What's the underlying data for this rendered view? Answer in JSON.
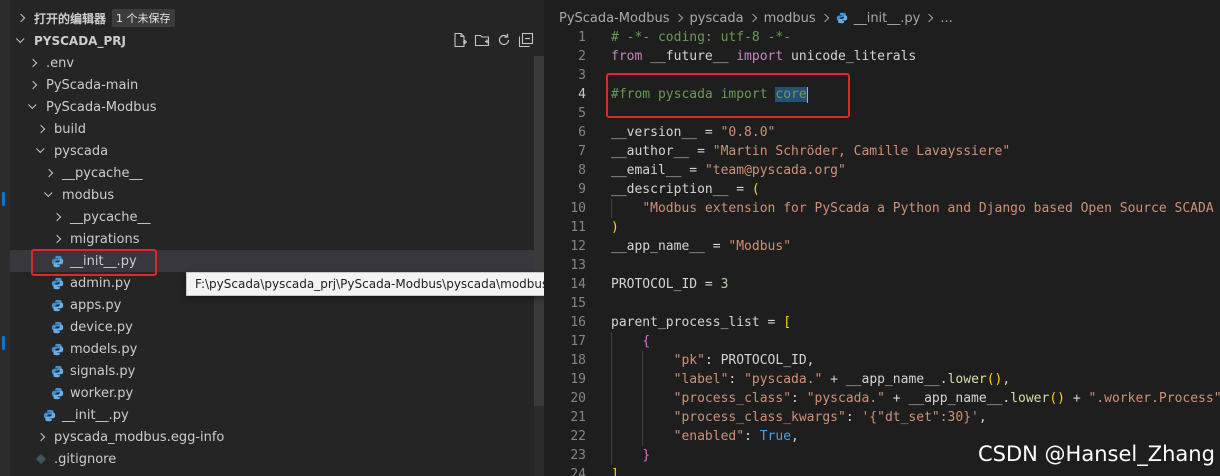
{
  "explorer": {
    "open_editors_label": "打开的编辑器",
    "unsaved_badge": "1 个未保存",
    "project_name": "PYSCADA_PRJ",
    "tree": [
      {
        "label": ".env",
        "kind": "folder",
        "expanded": false,
        "depth": 1
      },
      {
        "label": "PyScada-main",
        "kind": "folder",
        "expanded": false,
        "depth": 1
      },
      {
        "label": "PyScada-Modbus",
        "kind": "folder",
        "expanded": true,
        "depth": 1
      },
      {
        "label": "build",
        "kind": "folder",
        "expanded": false,
        "depth": 2
      },
      {
        "label": "pyscada",
        "kind": "folder",
        "expanded": true,
        "depth": 2
      },
      {
        "label": "__pycache__",
        "kind": "folder",
        "expanded": false,
        "depth": 3
      },
      {
        "label": "modbus",
        "kind": "folder",
        "expanded": true,
        "depth": 3
      },
      {
        "label": "__pycache__",
        "kind": "folder",
        "expanded": false,
        "depth": 4
      },
      {
        "label": "migrations",
        "kind": "folder",
        "expanded": false,
        "depth": 4
      },
      {
        "label": "__init__.py",
        "kind": "python",
        "depth": 4,
        "selected": true
      },
      {
        "label": "admin.py",
        "kind": "python",
        "depth": 4
      },
      {
        "label": "apps.py",
        "kind": "python",
        "depth": 4
      },
      {
        "label": "device.py",
        "kind": "python",
        "depth": 4
      },
      {
        "label": "models.py",
        "kind": "python",
        "depth": 4
      },
      {
        "label": "signals.py",
        "kind": "python",
        "depth": 4
      },
      {
        "label": "worker.py",
        "kind": "python",
        "depth": 4
      },
      {
        "label": "__init__.py",
        "kind": "python",
        "depth": 3
      },
      {
        "label": "pyscada_modbus.egg-info",
        "kind": "folder",
        "expanded": false,
        "depth": 2
      },
      {
        "label": ".gitignore",
        "kind": "git",
        "depth": 2
      }
    ],
    "tooltip": "F:\\pyScada\\pyscada_prj\\PyScada-Modbus\\pyscada\\modbus\\__init__.py"
  },
  "breadcrumb": {
    "items": [
      "PyScada-Modbus",
      "pyscada",
      "modbus",
      "__init__.py",
      "..."
    ]
  },
  "editor": {
    "current_line": 4,
    "lines": [
      {
        "n": "1",
        "indent": 0,
        "tokens": [
          {
            "t": "# -*- coding: utf-8 -*-",
            "c": "com"
          }
        ]
      },
      {
        "n": "2",
        "indent": 0,
        "tokens": [
          {
            "t": "from",
            "c": "kw2"
          },
          {
            "t": " __future__ ",
            "c": ""
          },
          {
            "t": "import",
            "c": "kw2"
          },
          {
            "t": " unicode_literals",
            "c": ""
          }
        ]
      },
      {
        "n": "3",
        "indent": 0,
        "tokens": []
      },
      {
        "n": "4",
        "indent": 0,
        "tokens": [
          {
            "t": "#from pyscada import ",
            "c": "com"
          },
          {
            "t": "core",
            "c": "com sel"
          },
          {
            "t": "",
            "c": "cursor"
          }
        ]
      },
      {
        "n": "5",
        "indent": 0,
        "tokens": []
      },
      {
        "n": "6",
        "indent": 0,
        "tokens": [
          {
            "t": "__version__",
            "c": ""
          },
          {
            "t": " = ",
            "c": ""
          },
          {
            "t": "\"0.8.0\"",
            "c": "str"
          }
        ]
      },
      {
        "n": "7",
        "indent": 0,
        "tokens": [
          {
            "t": "__author__",
            "c": ""
          },
          {
            "t": " = ",
            "c": ""
          },
          {
            "t": "\"Martin Schröder, Camille Lavayssiere\"",
            "c": "str"
          }
        ]
      },
      {
        "n": "8",
        "indent": 0,
        "tokens": [
          {
            "t": "__email__",
            "c": ""
          },
          {
            "t": " = ",
            "c": ""
          },
          {
            "t": "\"team@pyscada.org\"",
            "c": "str"
          }
        ]
      },
      {
        "n": "9",
        "indent": 0,
        "tokens": [
          {
            "t": "__description__",
            "c": ""
          },
          {
            "t": " = ",
            "c": ""
          },
          {
            "t": "(",
            "c": "br1"
          }
        ]
      },
      {
        "n": "10",
        "indent": 1,
        "tokens": [
          {
            "t": "    ",
            "c": ""
          },
          {
            "t": "\"Modbus extension for PyScada a Python and Django based Open Source SCADA System\"",
            "c": "str"
          }
        ]
      },
      {
        "n": "11",
        "indent": 0,
        "tokens": [
          {
            "t": ")",
            "c": "br1"
          }
        ]
      },
      {
        "n": "12",
        "indent": 0,
        "tokens": [
          {
            "t": "__app_name__",
            "c": ""
          },
          {
            "t": " = ",
            "c": ""
          },
          {
            "t": "\"Modbus\"",
            "c": "str"
          }
        ]
      },
      {
        "n": "13",
        "indent": 0,
        "tokens": []
      },
      {
        "n": "14",
        "indent": 0,
        "tokens": [
          {
            "t": "PROTOCOL_ID",
            "c": ""
          },
          {
            "t": " = ",
            "c": ""
          },
          {
            "t": "3",
            "c": "num"
          }
        ]
      },
      {
        "n": "15",
        "indent": 0,
        "tokens": []
      },
      {
        "n": "16",
        "indent": 0,
        "tokens": [
          {
            "t": "parent_process_list",
            "c": ""
          },
          {
            "t": " = ",
            "c": ""
          },
          {
            "t": "[",
            "c": "br1"
          }
        ]
      },
      {
        "n": "17",
        "indent": 1,
        "tokens": [
          {
            "t": "    ",
            "c": ""
          },
          {
            "t": "{",
            "c": "br2"
          }
        ]
      },
      {
        "n": "18",
        "indent": 2,
        "tokens": [
          {
            "t": "        ",
            "c": ""
          },
          {
            "t": "\"pk\"",
            "c": "str"
          },
          {
            "t": ": PROTOCOL_ID,",
            "c": ""
          }
        ]
      },
      {
        "n": "19",
        "indent": 2,
        "tokens": [
          {
            "t": "        ",
            "c": ""
          },
          {
            "t": "\"label\"",
            "c": "str"
          },
          {
            "t": ": ",
            "c": ""
          },
          {
            "t": "\"pyscada.\"",
            "c": "str"
          },
          {
            "t": " + __app_name__.",
            "c": ""
          },
          {
            "t": "lower",
            "c": "fn"
          },
          {
            "t": "()",
            "c": "br1"
          },
          {
            "t": ",",
            "c": ""
          }
        ]
      },
      {
        "n": "20",
        "indent": 2,
        "tokens": [
          {
            "t": "        ",
            "c": ""
          },
          {
            "t": "\"process_class\"",
            "c": "str"
          },
          {
            "t": ": ",
            "c": ""
          },
          {
            "t": "\"pyscada.\"",
            "c": "str"
          },
          {
            "t": " + __app_name__.",
            "c": ""
          },
          {
            "t": "lower",
            "c": "fn"
          },
          {
            "t": "()",
            "c": "br1"
          },
          {
            "t": " + ",
            "c": ""
          },
          {
            "t": "\".worker.Process\"",
            "c": "str"
          },
          {
            "t": ",",
            "c": ""
          }
        ]
      },
      {
        "n": "21",
        "indent": 2,
        "tokens": [
          {
            "t": "        ",
            "c": ""
          },
          {
            "t": "\"process_class_kwargs\"",
            "c": "str"
          },
          {
            "t": ": ",
            "c": ""
          },
          {
            "t": "'{\"dt_set\":30}'",
            "c": "str"
          },
          {
            "t": ",",
            "c": ""
          }
        ]
      },
      {
        "n": "22",
        "indent": 2,
        "tokens": [
          {
            "t": "        ",
            "c": ""
          },
          {
            "t": "\"enabled\"",
            "c": "str"
          },
          {
            "t": ": ",
            "c": ""
          },
          {
            "t": "True",
            "c": "kw"
          },
          {
            "t": ",",
            "c": ""
          }
        ]
      },
      {
        "n": "23",
        "indent": 1,
        "tokens": [
          {
            "t": "    ",
            "c": ""
          },
          {
            "t": "}",
            "c": "br2"
          }
        ]
      },
      {
        "n": "24",
        "indent": 0,
        "tokens": [
          {
            "t": "]",
            "c": "br1"
          }
        ]
      }
    ]
  },
  "watermark": "CSDN @Hansel_Zhang",
  "colors": {
    "highlight_box": "#e02828",
    "python_icon": "#3f8fd2",
    "selected_row": "#37373d"
  }
}
